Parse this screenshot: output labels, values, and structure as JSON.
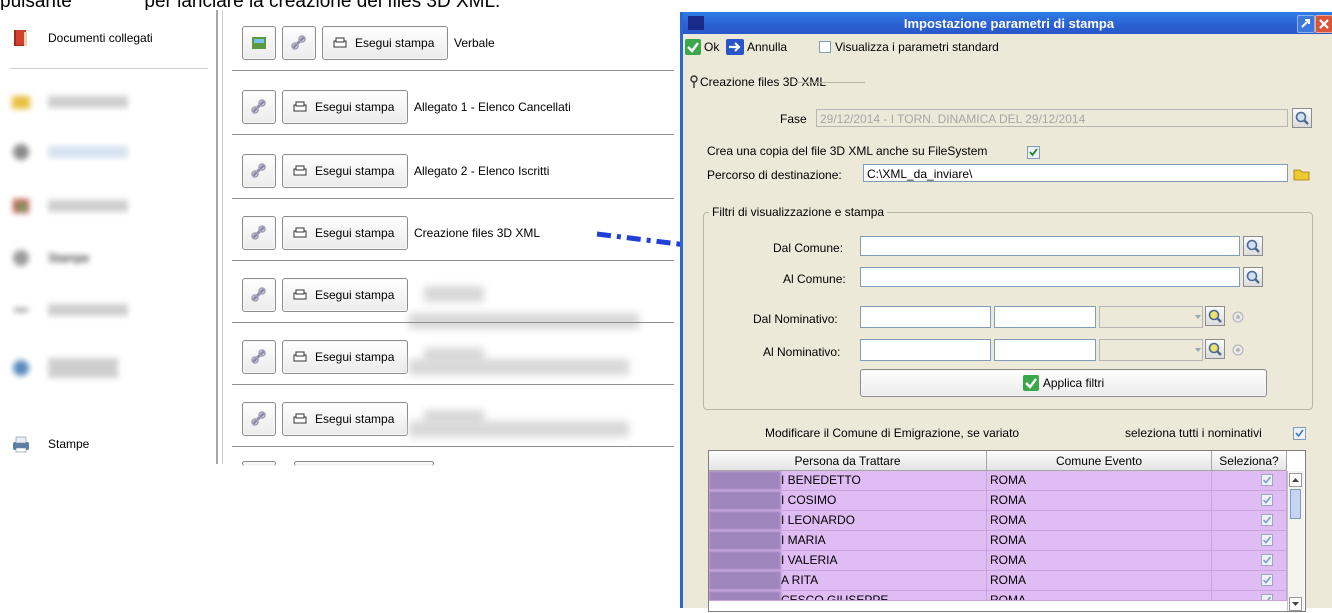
{
  "caption": {
    "prefix": "pulsante",
    "suffix": "per lanciare la creazione del files 3D XML."
  },
  "sidebar": {
    "items": [
      {
        "label": "Documenti collegati",
        "icon": "book-icon"
      },
      {
        "label": "",
        "icon": "folder-icon"
      },
      {
        "label": "",
        "icon": "gear-icon"
      },
      {
        "label": "",
        "icon": "chart-icon"
      },
      {
        "label": "Stampe",
        "icon": "gear-icon"
      },
      {
        "label": "",
        "icon": "tools-icon"
      },
      {
        "label": "",
        "icon": "globe-icon"
      },
      {
        "label": "Stampe",
        "icon": "printer-icon"
      }
    ]
  },
  "rows": [
    {
      "run_label": "Esegui stampa",
      "label": "Verbale"
    },
    {
      "run_label": "Esegui stampa",
      "label": "Allegato 1 - Elenco Cancellati"
    },
    {
      "run_label": "Esegui stampa",
      "label": "Allegato 2 - Elenco Iscritti"
    },
    {
      "run_label": "Esegui stampa",
      "label": "Creazione files 3D XML"
    },
    {
      "run_label": "Esegui stampa",
      "label": ""
    },
    {
      "run_label": "Esegui stampa",
      "label": ""
    },
    {
      "run_label": "Esegui stampa",
      "label": ""
    }
  ],
  "dialog": {
    "title": "Impostazione parametri di stampa",
    "toolbar": {
      "ok": "Ok",
      "annulla": "Annulla",
      "standard": "Visualizza i parametri standard"
    },
    "section_title": "Creazione files 3D XML",
    "fase_label": "Fase",
    "fase_value": "29/12/2014 - I TORN. DINAMICA DEL 29/12/2014",
    "copia_label": "Crea una copia del file 3D XML anche su FileSystem",
    "percorso_label": "Percorso di destinazione:",
    "percorso_value": "C:\\XML_da_inviare\\",
    "filtri_title": "Filtri di visualizzazione e stampa",
    "dal_comune": "Dal Comune:",
    "al_comune": "Al Comune:",
    "dal_nominativo": "Dal Nominativo:",
    "al_nominativo": "Al Nominativo:",
    "applica": "Applica filtri",
    "modificare": "Modificare il Comune di Emigrazione, se variato",
    "seleziona_tutti": "seleziona tutti i nominativi",
    "grid": {
      "headers": [
        "Persona da Trattare",
        "Comune Evento",
        "Seleziona?"
      ],
      "rows": [
        {
          "persona": "I BENEDETTO",
          "comune": "ROMA",
          "checked": true
        },
        {
          "persona": "I COSIMO",
          "comune": "ROMA",
          "checked": true
        },
        {
          "persona": "I LEONARDO",
          "comune": "ROMA",
          "checked": true
        },
        {
          "persona": "I MARIA",
          "comune": "ROMA",
          "checked": true
        },
        {
          "persona": "I VALERIA",
          "comune": "ROMA",
          "checked": true
        },
        {
          "persona": "A RITA",
          "comune": "ROMA",
          "checked": true
        },
        {
          "persona": "CESCO GIUSEPPE",
          "comune": "ROMA",
          "checked": true
        }
      ]
    }
  },
  "colors": {
    "titlebar": "#2b5fd2",
    "arrow": "#1f3fd6",
    "grid_row": "#e0bcf4",
    "dialog_bg": "#ece9d8"
  }
}
